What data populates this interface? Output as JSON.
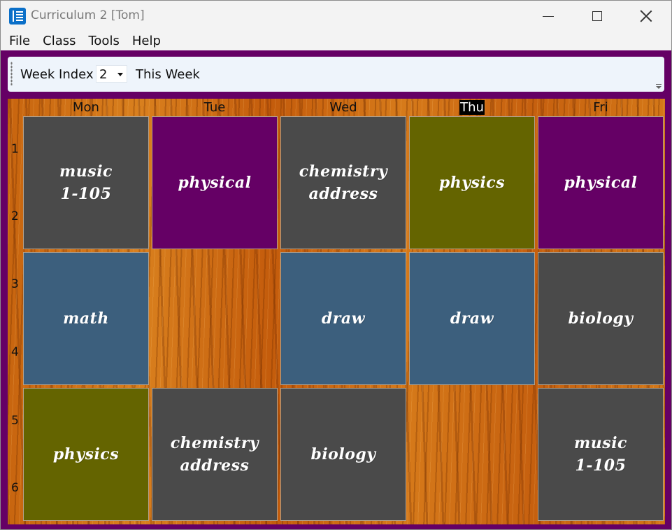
{
  "window": {
    "title": "Curriculum 2 [Tom]"
  },
  "menu": [
    "File",
    "Class",
    "Tools",
    "Help"
  ],
  "toolbar": {
    "week_label": "Week Index",
    "week_value": "2",
    "week_caption": "This Week"
  },
  "schedule": {
    "days": [
      "Mon",
      "Tue",
      "Wed",
      "Thu",
      "Fri"
    ],
    "today": "Thu",
    "periods": [
      "1",
      "2",
      "3",
      "4",
      "5",
      "6"
    ],
    "colors": {
      "gray": "#4a4a4a",
      "purple": "#650065",
      "olive": "#646400",
      "blue": "#3c5f7d"
    },
    "slots": [
      [
        {
          "day": "Mon",
          "block": 1,
          "lines": [
            "music",
            "1-105"
          ],
          "color": "gray"
        },
        {
          "day": "Tue",
          "block": 1,
          "lines": [
            "physical"
          ],
          "color": "purple"
        },
        {
          "day": "Wed",
          "block": 1,
          "lines": [
            "chemistry",
            "address"
          ],
          "color": "gray"
        },
        {
          "day": "Thu",
          "block": 1,
          "lines": [
            "physics"
          ],
          "color": "olive"
        },
        {
          "day": "Fri",
          "block": 1,
          "lines": [
            "physical"
          ],
          "color": "purple"
        }
      ],
      [
        {
          "day": "Mon",
          "block": 2,
          "lines": [
            "math"
          ],
          "color": "blue"
        },
        null,
        {
          "day": "Wed",
          "block": 2,
          "lines": [
            "draw"
          ],
          "color": "blue"
        },
        {
          "day": "Thu",
          "block": 2,
          "lines": [
            "draw"
          ],
          "color": "blue"
        },
        {
          "day": "Fri",
          "block": 2,
          "lines": [
            "biology"
          ],
          "color": "gray"
        }
      ],
      [
        {
          "day": "Mon",
          "block": 3,
          "lines": [
            "physics"
          ],
          "color": "olive"
        },
        {
          "day": "Tue",
          "block": 3,
          "lines": [
            "chemistry",
            "address"
          ],
          "color": "gray"
        },
        {
          "day": "Wed",
          "block": 3,
          "lines": [
            "biology"
          ],
          "color": "gray"
        },
        null,
        {
          "day": "Fri",
          "block": 3,
          "lines": [
            "music",
            "1-105"
          ],
          "color": "gray"
        }
      ]
    ]
  }
}
